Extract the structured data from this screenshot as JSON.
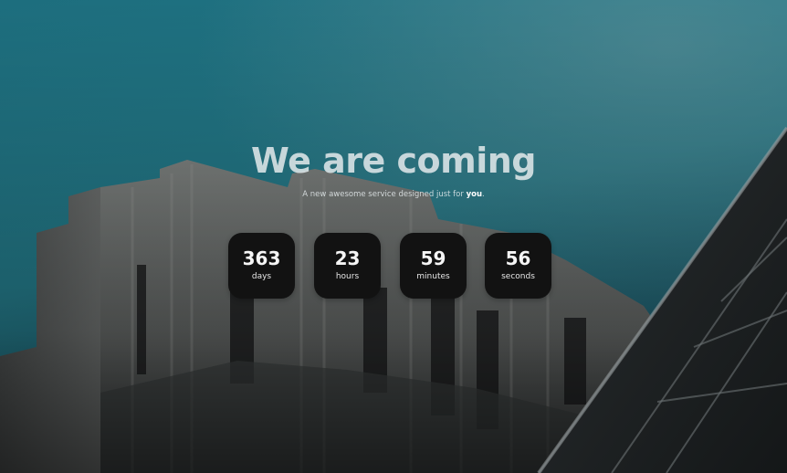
{
  "hero": {
    "title": "We are coming",
    "subtitle_prefix": "A new awesome service designed just for ",
    "subtitle_emphasis": "you",
    "subtitle_suffix": "."
  },
  "countdown": [
    {
      "value": "363",
      "label": "days"
    },
    {
      "value": "23",
      "label": "hours"
    },
    {
      "value": "59",
      "label": "minutes"
    },
    {
      "value": "56",
      "label": "seconds"
    }
  ],
  "colors": {
    "sky_top": "#22717f",
    "sky_bottom": "#1f5866",
    "tile_background": "#121212",
    "title_text": "#dde5e7"
  },
  "background": {
    "image": "building-photo"
  }
}
